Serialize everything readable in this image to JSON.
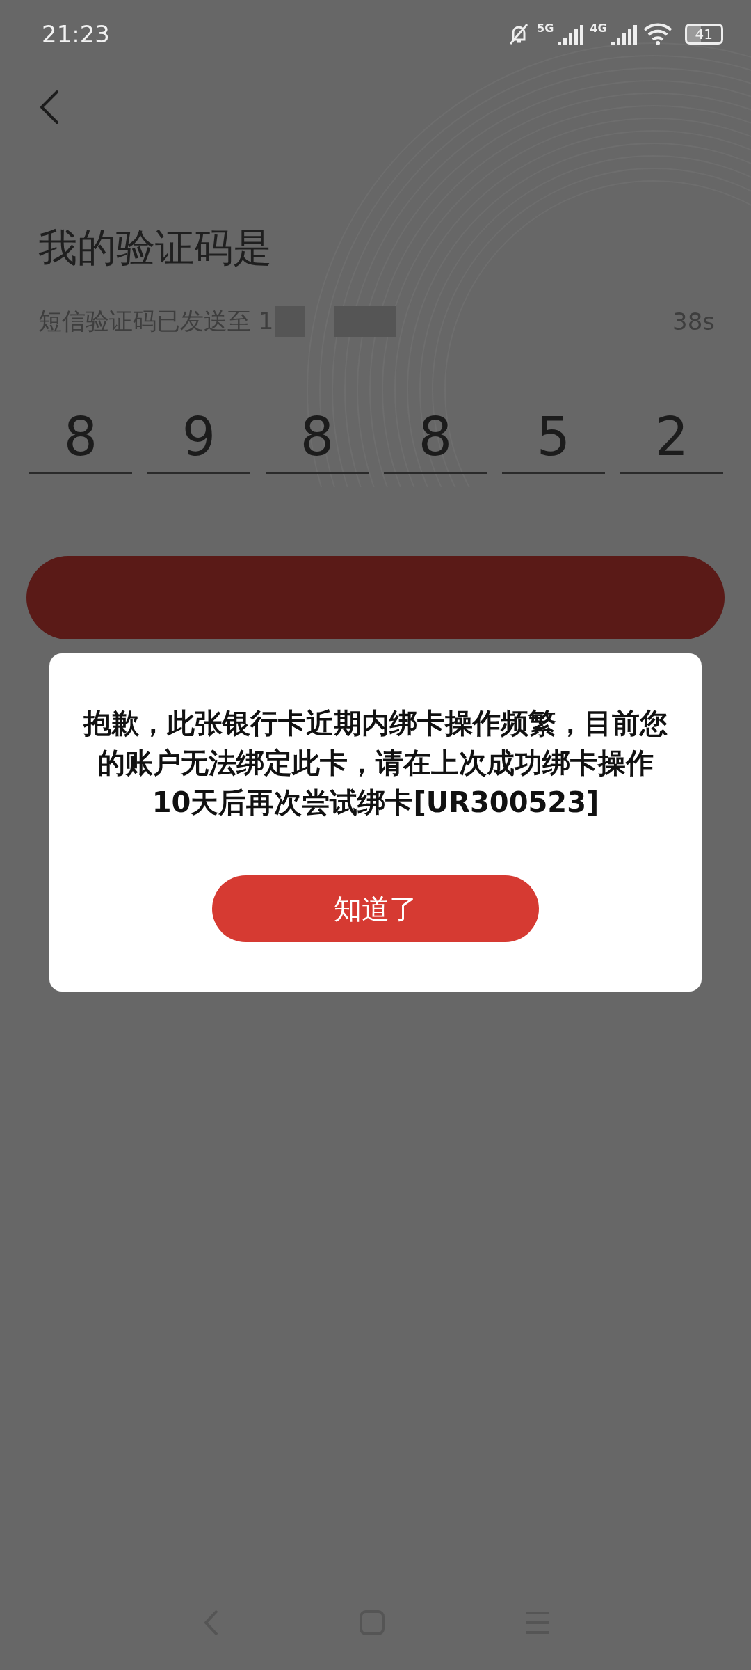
{
  "status_bar": {
    "time": "21:23",
    "network_1": "5G",
    "network_2": "4G",
    "battery": "41"
  },
  "title": "我的验证码是",
  "subtitle": {
    "text": "短信验证码已发送至 1",
    "countdown": "38s"
  },
  "code": {
    "digits": [
      "8",
      "9",
      "8",
      "8",
      "5",
      "2"
    ]
  },
  "dialog": {
    "message": "抱歉，此张银行卡近期内绑卡操作频繁，目前您的账户无法绑定此卡，请在上次成功绑卡操作10天后再次尝试绑卡[UR300523]",
    "button": "知道了"
  }
}
